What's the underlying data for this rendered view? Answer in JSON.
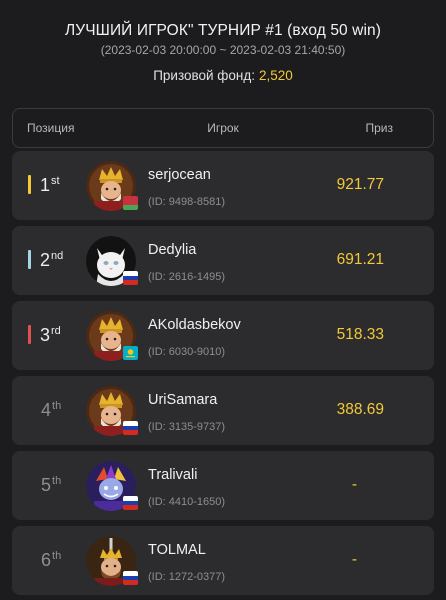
{
  "header": {
    "title": "ЛУЧШИЙ ИГРОК\" ТУРНИР #1 (вход 50 win)",
    "dates": "(2023-02-03 20:00:00 ~ 2023-02-03 21:40:50)",
    "prize_pool_label": "Призовой фонд:",
    "prize_pool_value": "2,520"
  },
  "columns": {
    "position": "Позиция",
    "player": "Игрок",
    "prize": "Приз"
  },
  "colors": {
    "gold": "#f4c838",
    "silver": "#9fd8e4",
    "bronze": "#e0504c",
    "background": "#1c1c1e",
    "row_background": "#2c2c2e"
  },
  "rows": [
    {
      "rank": "1",
      "suffix": "st",
      "name": "serjocean",
      "id": "(ID: 9498-8581)",
      "prize": "921.77",
      "flag": "belarus-flag",
      "avatar": "king-avatar"
    },
    {
      "rank": "2",
      "suffix": "nd",
      "name": "Dedylia",
      "id": "(ID: 2616-1495)",
      "prize": "691.21",
      "flag": "russia-flag",
      "avatar": "white-cat-avatar"
    },
    {
      "rank": "3",
      "suffix": "rd",
      "name": "AKoldasbekov",
      "id": "(ID: 6030-9010)",
      "prize": "518.33",
      "flag": "kazakhstan-flag",
      "avatar": "king-avatar"
    },
    {
      "rank": "4",
      "suffix": "th",
      "name": "UriSamara",
      "id": "(ID: 3135-9737)",
      "prize": "388.69",
      "flag": "russia-flag",
      "avatar": "king-avatar"
    },
    {
      "rank": "5",
      "suffix": "th",
      "name": "Tralivali",
      "id": "(ID: 4410-1650)",
      "prize": "-",
      "flag": "russia-flag",
      "avatar": "jester-avatar"
    },
    {
      "rank": "6",
      "suffix": "th",
      "name": "TOLMAL",
      "id": "(ID: 1272-0377)",
      "prize": "-",
      "flag": "russia-flag",
      "avatar": "sword-king-avatar"
    }
  ]
}
